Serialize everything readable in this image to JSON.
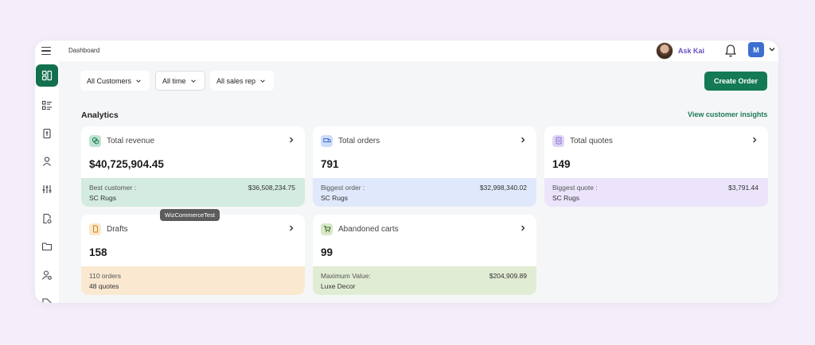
{
  "header": {
    "breadcrumb": "Dashboard",
    "assistant_label": "Ask Kai",
    "user_initial": "M"
  },
  "sidebar": {
    "items": [
      {
        "icon": "dashboard-icon",
        "active": true
      },
      {
        "icon": "list-icon"
      },
      {
        "icon": "document-icon"
      },
      {
        "icon": "person-icon"
      },
      {
        "icon": "sliders-icon"
      },
      {
        "icon": "file-settings-icon"
      },
      {
        "icon": "folder-icon"
      },
      {
        "icon": "user-settings-icon"
      },
      {
        "icon": "tag-icon"
      }
    ]
  },
  "filters": {
    "customers": "All Customers",
    "time": "All time",
    "sales_rep": "All sales rep"
  },
  "actions": {
    "create_order": "Create Order"
  },
  "analytics": {
    "title": "Analytics",
    "insights_link": "View customer insights"
  },
  "cards": {
    "revenue": {
      "label": "Total revenue",
      "value": "$40,725,904.45",
      "foot_label": "Best customer :",
      "foot_name": "SC Rugs",
      "foot_value": "$36,508,234.75",
      "color": "#d3ebe0",
      "icon_color": "#bfe3d2"
    },
    "orders": {
      "label": "Total orders",
      "value": "791",
      "foot_label": "Biggest order :",
      "foot_name": "SC Rugs",
      "foot_value": "$32,998,340.02",
      "color": "#dfe9fb",
      "icon_color": "#cfdcf7"
    },
    "quotes": {
      "label": "Total quotes",
      "value": "149",
      "foot_label": "Biggest quote :",
      "foot_name": "SC Rugs",
      "foot_value": "$3,791.44",
      "color": "#ece4fb",
      "icon_color": "#e0d4f7"
    },
    "drafts": {
      "label": "Drafts",
      "value": "158",
      "foot_label": "110 orders",
      "foot_name": "48 quotes",
      "color": "#fbe8d1",
      "icon_color": "#fde6c5"
    },
    "carts": {
      "label": "Abandoned carts",
      "value": "99",
      "foot_label": "Maximum Value:",
      "foot_name": "Luxe Decor",
      "foot_value": "$204,909.89",
      "color": "#e1ecd4",
      "icon_color": "#d8e8c8"
    }
  },
  "tooltip": "WizCommerceTest",
  "colors": {
    "accent": "#137a54",
    "page_bg": "#f3eef9",
    "user_badge": "#3d6fd1"
  }
}
